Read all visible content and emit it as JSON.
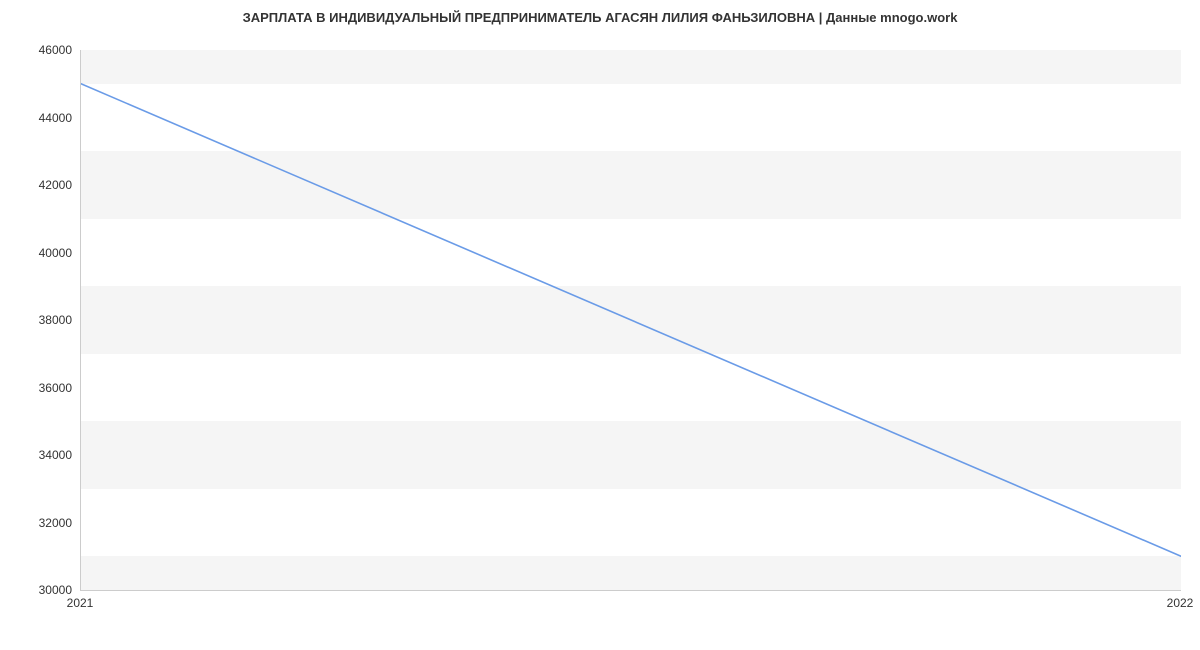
{
  "chart_data": {
    "type": "line",
    "title": "ЗАРПЛАТА В ИНДИВИДУАЛЬНЫЙ ПРЕДПРИНИМАТЕЛЬ АГАСЯН ЛИЛИЯ ФАНЬЗИЛОВНА | Данные mnogo.work",
    "x": [
      2021,
      2022
    ],
    "values": [
      45000,
      31000
    ],
    "xlabel": "",
    "ylabel": "",
    "xlim": [
      2021,
      2022
    ],
    "ylim": [
      30000,
      46000
    ],
    "y_ticks": [
      30000,
      32000,
      34000,
      36000,
      38000,
      40000,
      42000,
      44000,
      46000
    ],
    "x_ticks": [
      2021,
      2022
    ],
    "line_color": "#6A9BE7"
  }
}
